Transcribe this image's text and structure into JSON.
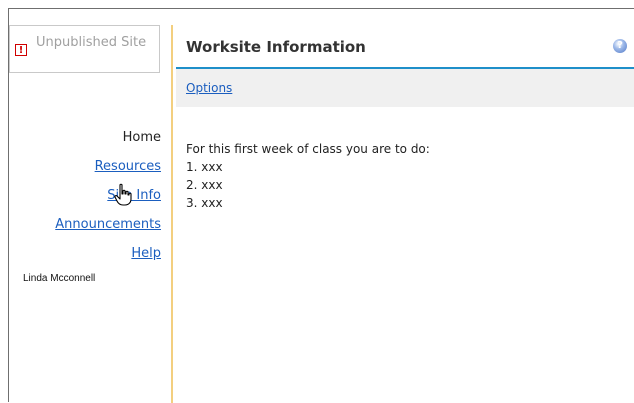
{
  "site_status": {
    "icon": "warning-icon",
    "label": "Unpublished Site",
    "warning_color": "#d00000"
  },
  "nav": {
    "items": [
      {
        "label": "Home",
        "current": true
      },
      {
        "label": "Resources",
        "current": false
      },
      {
        "label": "Site Info",
        "current": false
      },
      {
        "label": "Announcements",
        "current": false
      },
      {
        "label": "Help",
        "current": false
      }
    ],
    "link_color": "#1b5ebf"
  },
  "user": {
    "name": "Linda Mcconnell"
  },
  "tool": {
    "title": "Worksite Information",
    "help_icon": "help-icon",
    "options_label": "Options"
  },
  "content": {
    "intro": "For this first week of class you are to do:",
    "lines": [
      "1. xxx",
      "2. xxx",
      "3. xxx"
    ]
  },
  "theme": {
    "divider_color": "#f3cf7f",
    "title_rule_color": "#1e8fc9",
    "options_bar_bg": "#f0f0f0"
  },
  "cursor": {
    "icon": "hand-pointer-icon"
  }
}
